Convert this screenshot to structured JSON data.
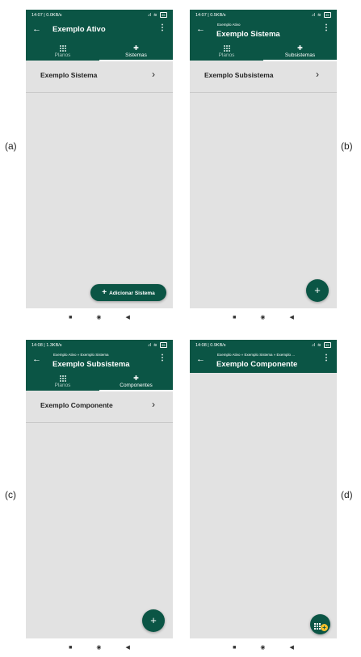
{
  "labels": [
    "(a)",
    "(b)",
    "(c)",
    "(d)"
  ],
  "colors": {
    "primary": "#0b5545",
    "background": "#e2e2e2",
    "fab_badge": "#f6c12c"
  },
  "screens": {
    "a": {
      "status": {
        "left": "14:07 | 0.0KB/s",
        "battery": "35"
      },
      "title": "Exemplo Ativo",
      "tabs": [
        {
          "label": "Planos",
          "icon": "grid-icon"
        },
        {
          "label": "Sistemas",
          "icon": "puzzle-icon"
        }
      ],
      "active_tab": 1,
      "rows": [
        "Exemplo Sistema"
      ],
      "fab_label": "Adicionar Sistema"
    },
    "b": {
      "status": {
        "left": "14:07 | 0.5KB/s",
        "battery": "35"
      },
      "breadcrumb": "Exemplo Ativo",
      "title": "Exemplo Sistema",
      "tabs": [
        {
          "label": "Planos",
          "icon": "grid-icon"
        },
        {
          "label": "Subsistemas",
          "icon": "puzzle-icon"
        }
      ],
      "active_tab": 1,
      "rows": [
        "Exemplo Subsistema"
      ],
      "fab_label": "+"
    },
    "c": {
      "status": {
        "left": "14:08 | 1.3KB/s",
        "battery": "35"
      },
      "breadcrumb": "Exemplo Ativo  »  Exemplo Sistema",
      "title": "Exemplo Subsistema",
      "tabs": [
        {
          "label": "Planos",
          "icon": "grid-icon"
        },
        {
          "label": "Componentes",
          "icon": "puzzle-icon"
        }
      ],
      "active_tab": 1,
      "rows": [
        "Exemplo Componente"
      ],
      "fab_label": "+"
    },
    "d": {
      "status": {
        "left": "14:08 | 0.9KB/s",
        "battery": "35"
      },
      "breadcrumb": "Exemplo Ativo  »  Exemplo Sistema  »  Exemplo ...",
      "title": "Exemplo Componente",
      "fab_label": "+"
    }
  },
  "navbar": {
    "square": "■",
    "circle": "◉",
    "back": "◀"
  }
}
